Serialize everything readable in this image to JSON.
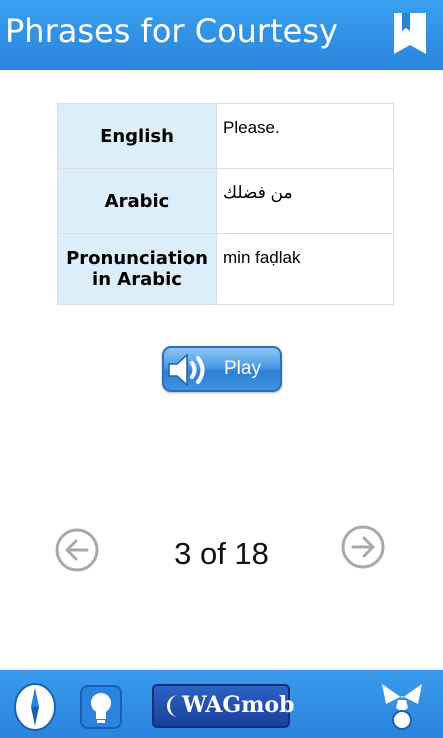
{
  "header": {
    "title": "Phrases for Courtesy",
    "bookmark_icon": "bookmark-icon"
  },
  "phrase": {
    "rows": [
      {
        "label": "English",
        "value": "Please."
      },
      {
        "label": "Arabic",
        "value": "من فضلك"
      },
      {
        "label": "Pronunciation in Arabic",
        "value": "min faḍlak"
      }
    ]
  },
  "player": {
    "play_label": "Play",
    "icon": "speaker-icon"
  },
  "pager": {
    "indicator": "3 of 18",
    "prev_icon": "arrow-left-circle-icon",
    "next_icon": "arrow-right-circle-icon"
  },
  "footer": {
    "brand_label": "WAGmob",
    "icons": [
      "compass-icon",
      "lightbulb-icon",
      "wagmob-moon-icon",
      "mentor-icon"
    ]
  },
  "colors": {
    "header": "#2e8fe6",
    "label_cell": "#dceefa",
    "play_button": "#4a9be6",
    "brand_button": "#1a3f9c"
  }
}
